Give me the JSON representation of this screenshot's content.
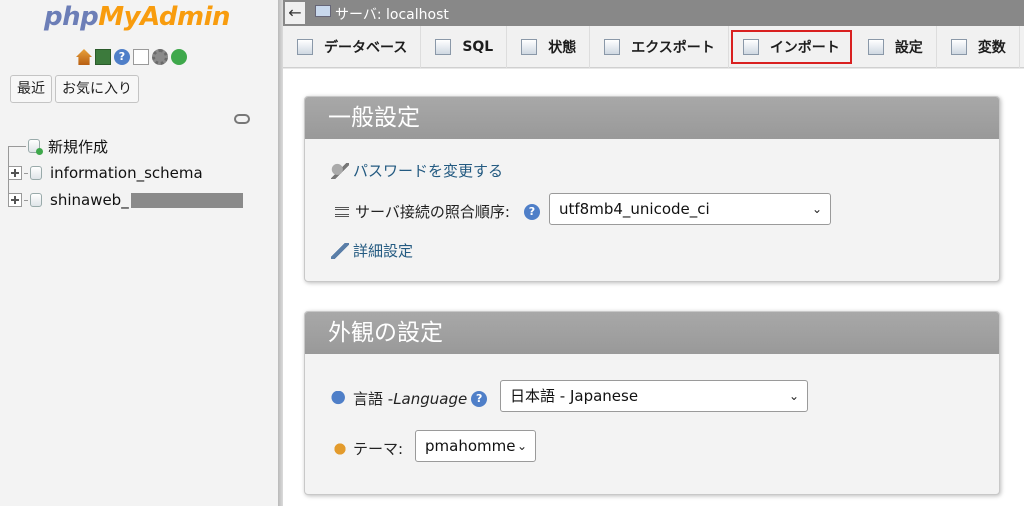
{
  "logo": {
    "php": "php",
    "my": "My",
    "admin": "Admin"
  },
  "quick_icons": [
    "home-icon",
    "exit-icon",
    "help-icon",
    "docs-icon",
    "settings-gear-icon",
    "reload-icon"
  ],
  "sidebar": {
    "tabs": [
      {
        "label": "最近"
      },
      {
        "label": "お気に入り"
      }
    ],
    "tree": [
      {
        "label": "新規作成"
      },
      {
        "label": "information_schema"
      },
      {
        "label": "shinaweb_"
      }
    ]
  },
  "topbar": {
    "back": "←",
    "server_label": "サーバ: localhost"
  },
  "tabs": [
    {
      "label": "データベース"
    },
    {
      "label": "SQL"
    },
    {
      "label": "状態"
    },
    {
      "label": "エクスポート"
    },
    {
      "label": "インポート"
    },
    {
      "label": "設定"
    },
    {
      "label": "変数"
    }
  ],
  "general": {
    "title": "一般設定",
    "change_password": "パスワードを変更する",
    "collation_label": "サーバ接続の照合順序:",
    "collation_value": "utf8mb4_unicode_ci",
    "more_settings": "詳細設定"
  },
  "appearance": {
    "title": "外観の設定",
    "language_label": "言語 - ",
    "language_label_en": "Language",
    "language_value": "日本語 - Japanese",
    "theme_label": "テーマ:",
    "theme_value": "pmahomme"
  },
  "colors": {
    "accent_border": "#d92020",
    "link": "#235a81",
    "panel_header": "#a0a0a0"
  }
}
